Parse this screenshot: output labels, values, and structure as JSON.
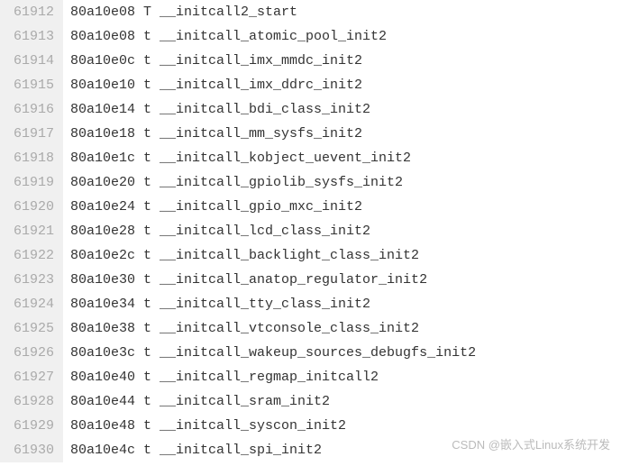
{
  "lines": [
    {
      "num": "61912",
      "addr": "80a10e08",
      "type": "T",
      "symbol": "__initcall2_start"
    },
    {
      "num": "61913",
      "addr": "80a10e08",
      "type": "t",
      "symbol": "__initcall_atomic_pool_init2"
    },
    {
      "num": "61914",
      "addr": "80a10e0c",
      "type": "t",
      "symbol": "__initcall_imx_mmdc_init2"
    },
    {
      "num": "61915",
      "addr": "80a10e10",
      "type": "t",
      "symbol": "__initcall_imx_ddrc_init2"
    },
    {
      "num": "61916",
      "addr": "80a10e14",
      "type": "t",
      "symbol": "__initcall_bdi_class_init2"
    },
    {
      "num": "61917",
      "addr": "80a10e18",
      "type": "t",
      "symbol": "__initcall_mm_sysfs_init2"
    },
    {
      "num": "61918",
      "addr": "80a10e1c",
      "type": "t",
      "symbol": "__initcall_kobject_uevent_init2"
    },
    {
      "num": "61919",
      "addr": "80a10e20",
      "type": "t",
      "symbol": "__initcall_gpiolib_sysfs_init2"
    },
    {
      "num": "61920",
      "addr": "80a10e24",
      "type": "t",
      "symbol": "__initcall_gpio_mxc_init2"
    },
    {
      "num": "61921",
      "addr": "80a10e28",
      "type": "t",
      "symbol": "__initcall_lcd_class_init2"
    },
    {
      "num": "61922",
      "addr": "80a10e2c",
      "type": "t",
      "symbol": "__initcall_backlight_class_init2"
    },
    {
      "num": "61923",
      "addr": "80a10e30",
      "type": "t",
      "symbol": "__initcall_anatop_regulator_init2"
    },
    {
      "num": "61924",
      "addr": "80a10e34",
      "type": "t",
      "symbol": "__initcall_tty_class_init2"
    },
    {
      "num": "61925",
      "addr": "80a10e38",
      "type": "t",
      "symbol": "__initcall_vtconsole_class_init2"
    },
    {
      "num": "61926",
      "addr": "80a10e3c",
      "type": "t",
      "symbol": "__initcall_wakeup_sources_debugfs_init2"
    },
    {
      "num": "61927",
      "addr": "80a10e40",
      "type": "t",
      "symbol": "__initcall_regmap_initcall2"
    },
    {
      "num": "61928",
      "addr": "80a10e44",
      "type": "t",
      "symbol": "__initcall_sram_init2"
    },
    {
      "num": "61929",
      "addr": "80a10e48",
      "type": "t",
      "symbol": "__initcall_syscon_init2"
    },
    {
      "num": "61930",
      "addr": "80a10e4c",
      "type": "t",
      "symbol": "__initcall_spi_init2"
    }
  ],
  "watermark": "CSDN @嵌入式Linux系统开发"
}
